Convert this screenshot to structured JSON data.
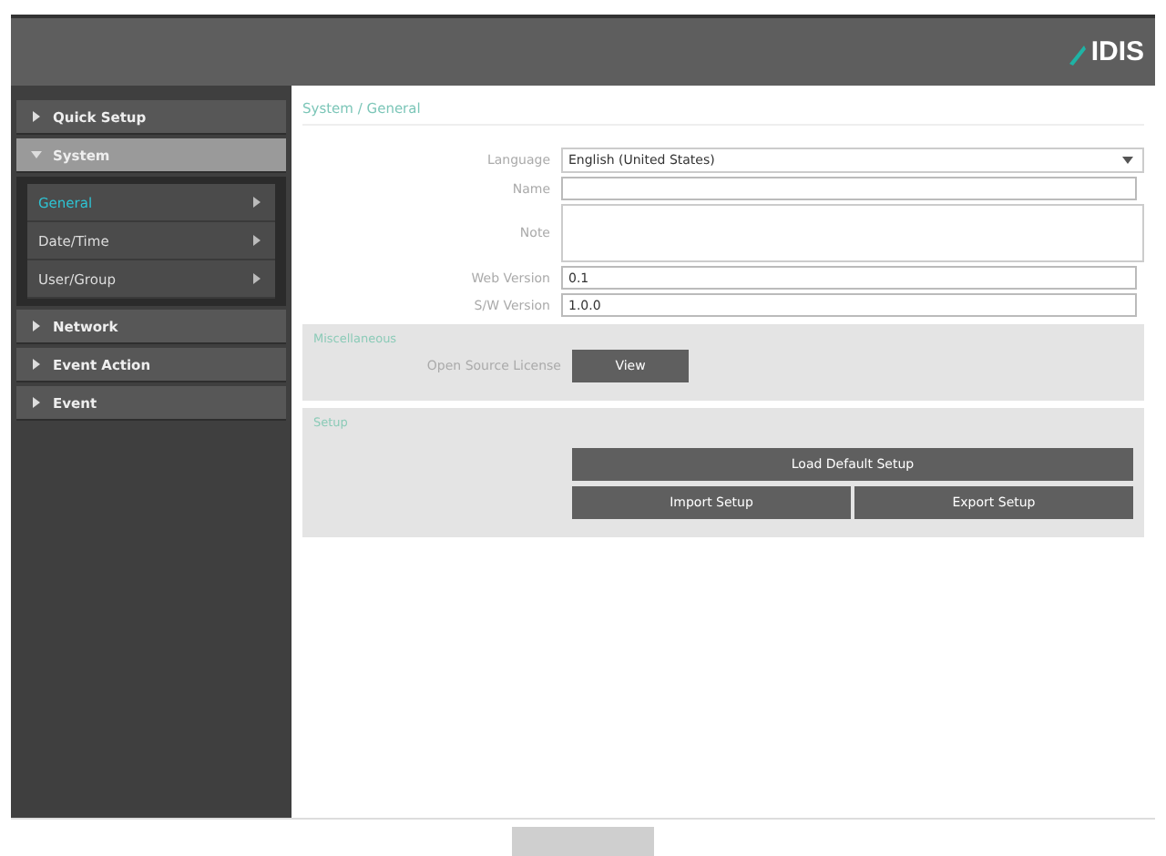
{
  "header": {
    "logo": "IDIS"
  },
  "sidebar": {
    "items": [
      {
        "label": "Quick Setup",
        "expanded": false,
        "selected": false
      },
      {
        "label": "System",
        "expanded": true,
        "selected": true,
        "children": [
          {
            "label": "General",
            "selected": true
          },
          {
            "label": "Date/Time",
            "selected": false
          },
          {
            "label": "User/Group",
            "selected": false
          }
        ]
      },
      {
        "label": "Network",
        "expanded": false,
        "selected": false
      },
      {
        "label": "Event Action",
        "expanded": false,
        "selected": false
      },
      {
        "label": "Event",
        "expanded": false,
        "selected": false
      }
    ]
  },
  "breadcrumb": "System / General",
  "fields": [
    {
      "kind": "select",
      "label": "Language",
      "value": "English (United States)"
    },
    {
      "kind": "input",
      "label": "Name"
    },
    {
      "kind": "textarea",
      "label": "Note"
    },
    {
      "kind": "input",
      "label": "Web Version",
      "value": "0.1"
    },
    {
      "kind": "input",
      "label": "S/W Version",
      "value": "1.0.0"
    }
  ],
  "misc": {
    "title": "Miscellaneous",
    "label": "Open Source License",
    "button": "View"
  },
  "setup": {
    "title": "Setup",
    "load_default": "Load Default Setup",
    "import": "Import Setup",
    "export": "Export Setup"
  },
  "footer": {
    "apply_disabled": true
  }
}
